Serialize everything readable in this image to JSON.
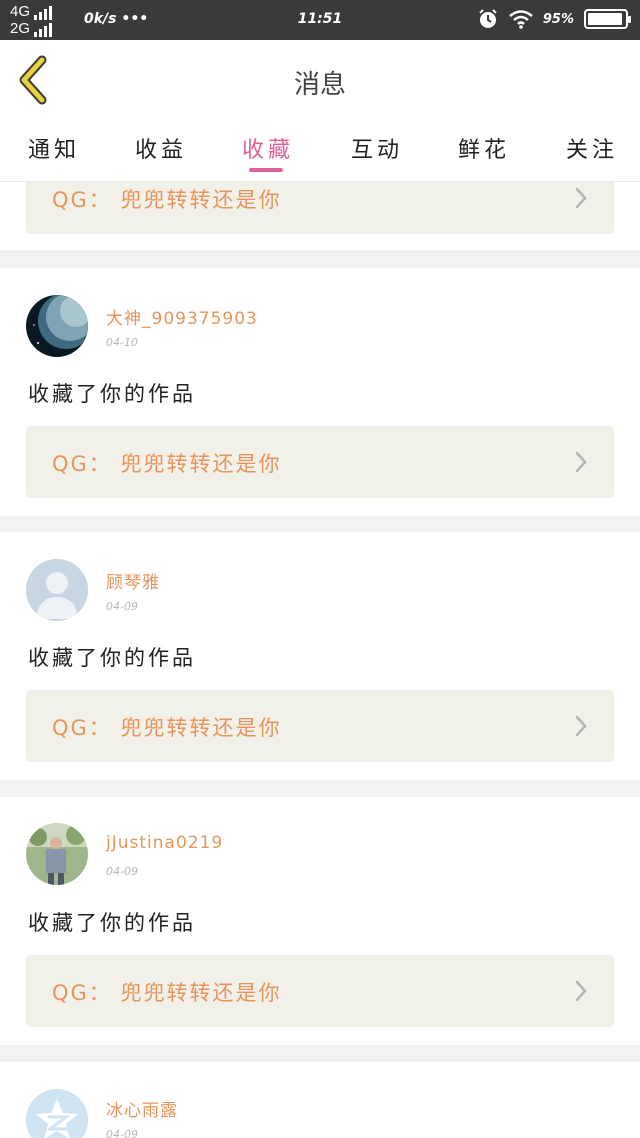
{
  "status_bar": {
    "network_top": "4G",
    "network_bottom": "2G",
    "speed": "0k/s •••",
    "time": "11:51",
    "battery": "95%",
    "battery_level": 0.95
  },
  "header": {
    "title": "消息"
  },
  "tabs": [
    {
      "label": "通知",
      "active": false
    },
    {
      "label": "收益",
      "active": false
    },
    {
      "label": "收藏",
      "active": true
    },
    {
      "label": "互动",
      "active": false
    },
    {
      "label": "鲜花",
      "active": false
    },
    {
      "label": "关注",
      "active": false
    }
  ],
  "messages": [
    {
      "work": "QG： 兜兜转转还是你"
    },
    {
      "username": "大神_909375903",
      "date": "04-10",
      "action": "收藏了你的作品",
      "work": "QG： 兜兜转转还是你",
      "avatar": "planet-avatar"
    },
    {
      "username": "顾琴雅",
      "date": "04-09",
      "action": "收藏了你的作品",
      "work": "QG： 兜兜转转还是你",
      "avatar": "default-person-avatar"
    },
    {
      "username": "jJustina0219",
      "date": "04-09",
      "action": "收藏了你的作品",
      "work": "QG： 兜兜转转还是你",
      "avatar": "photo-avatar"
    },
    {
      "username": "冰心雨露",
      "date": "04-09",
      "avatar": "qzone-avatar"
    }
  ],
  "colors": {
    "accent": "#e0609a",
    "username": "#e8945a",
    "work_bg": "#f2f1e9",
    "status_bar": "#3a3a3a",
    "back_arrow": "#e8d23a"
  }
}
